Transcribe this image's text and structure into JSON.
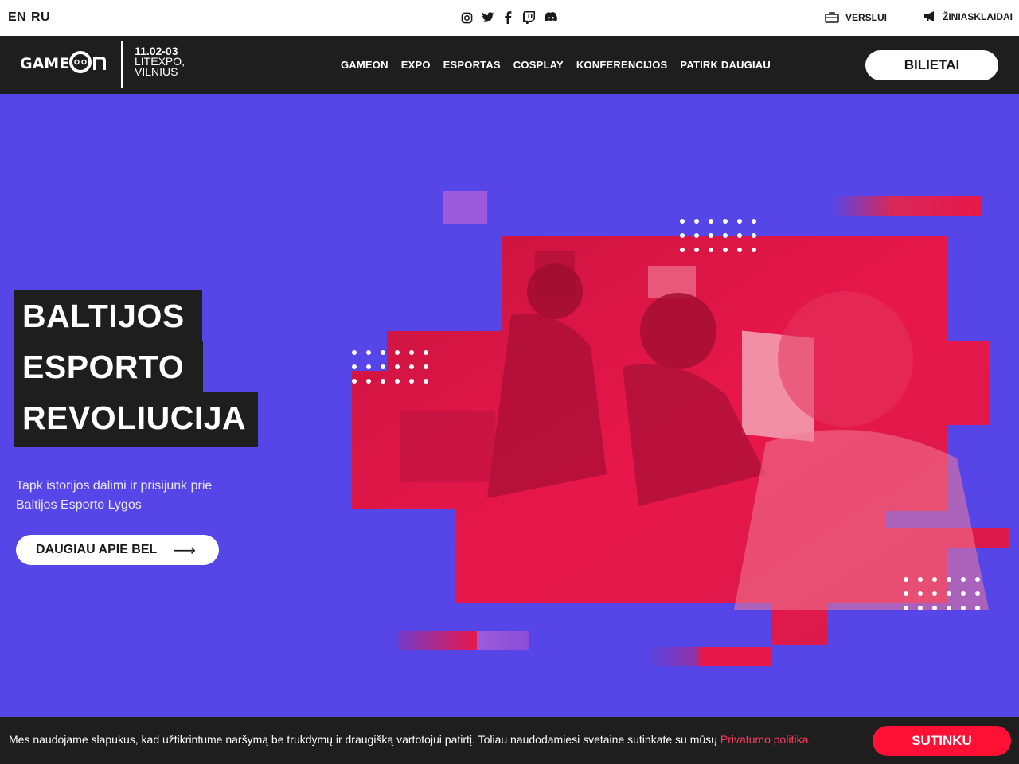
{
  "topbar": {
    "languages": [
      "EN",
      "RU"
    ],
    "social_icons": [
      "instagram-icon",
      "twitter-icon",
      "facebook-icon",
      "twitch-icon",
      "discord-icon"
    ],
    "business_label": "VERSLUI",
    "media_label": "ŽINIASKLAIDAI"
  },
  "navbar": {
    "logo_text": "GAMEON",
    "event_date": "11.02-03",
    "event_venue": "LITEXPO, VILNIUS",
    "links": [
      "GAMEON",
      "EXPO",
      "ESPORTAS",
      "COSPLAY",
      "KONFERENCIJOS",
      "PATIRK DAUGIAU"
    ],
    "tickets_label": "BILIETAI"
  },
  "hero": {
    "title_lines": [
      "BALTIJOS",
      "ESPORTO",
      "REVOLIUCIJA"
    ],
    "subtitle": "Tapk istorijos dalimi ir prisijunk prie Baltijos Esporto Lygos",
    "cta_label": "DAUGIAU APIE BEL",
    "cta_arrow": "⟶"
  },
  "cookie": {
    "text": "Mes naudojame slapukus, kad užtikrintume naršymą be trukdymų ir draugišką vartotojui patirtį. Toliau naudodamiesi svetaine sutinkate su mūsų ",
    "link_label": "Privatumo politika",
    "suffix": ".",
    "accept_label": "SUTINKU"
  },
  "colors": {
    "background": "#5646e8",
    "dark": "#1e1e1e",
    "accent_red": "#e8174a",
    "accept": "#ff1034"
  }
}
